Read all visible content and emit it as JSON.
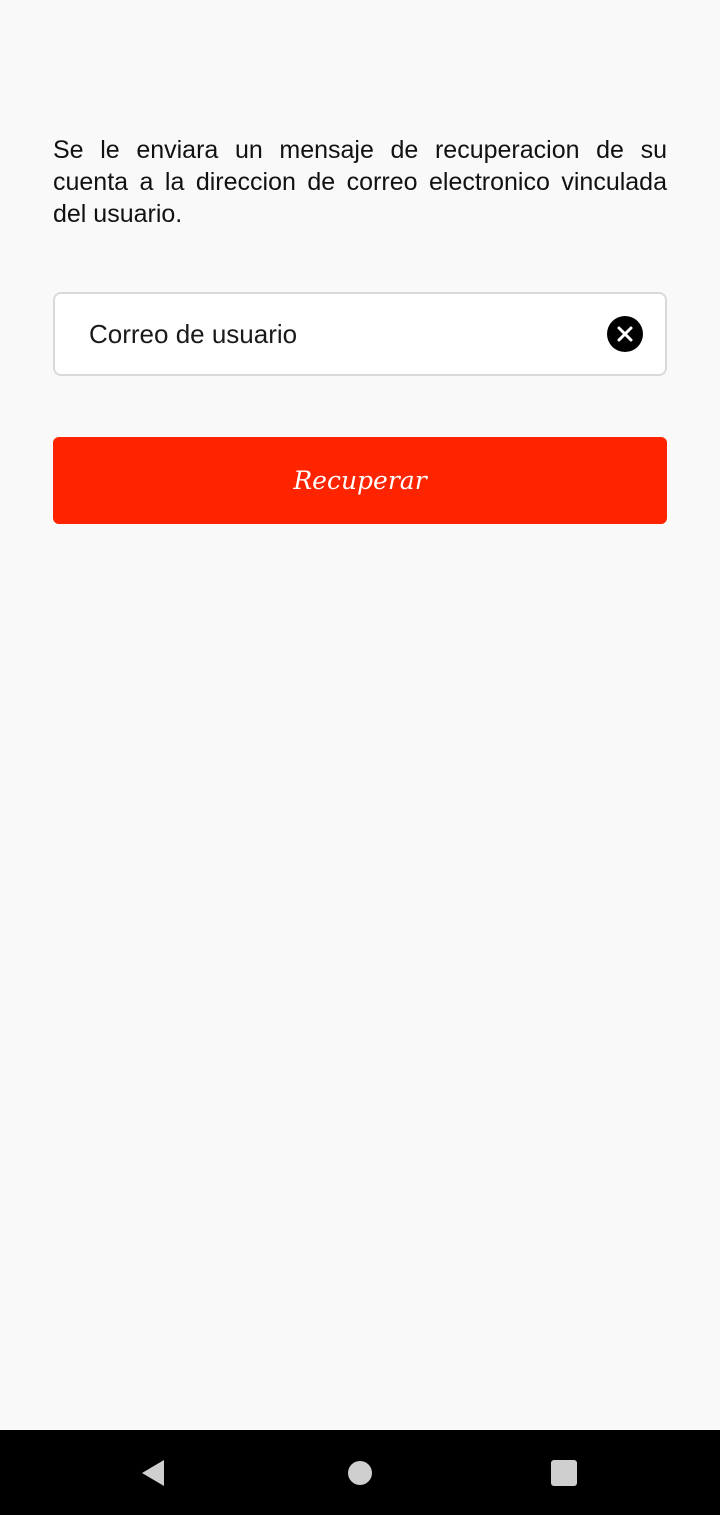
{
  "instructions": "Se le enviara un mensaje de recuperacion de su cuenta a la direccion de correo electronico vinculada del usuario.",
  "email_field": {
    "placeholder": "Correo de usuario",
    "value": "",
    "clear_icon": "close-circle-icon"
  },
  "recover_button": {
    "label": "Recuperar",
    "background": "#ff2400",
    "text_color": "#ffffff"
  },
  "nav_bar": {
    "back_icon": "triangle-back-icon",
    "home_icon": "circle-home-icon",
    "recents_icon": "square-recents-icon"
  }
}
